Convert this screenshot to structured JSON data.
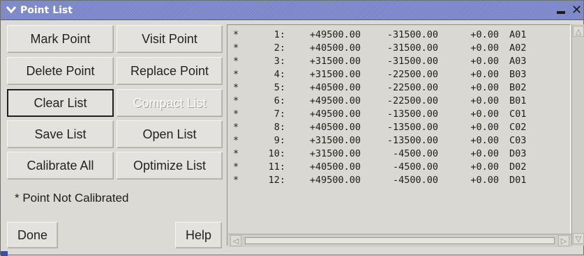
{
  "window": {
    "title": "Point List",
    "menu_icon": "chevron-down-icon",
    "minimize_glyph": "▬",
    "close_glyph": "✕",
    "title_bar_color": "#7b86c8"
  },
  "buttons": {
    "mark_point": "Mark Point",
    "visit_point": "Visit Point",
    "delete_point": "Delete Point",
    "replace_point": "Replace Point",
    "clear_list": "Clear List",
    "compact_list": "Compact List",
    "save_list": "Save List",
    "open_list": "Open List",
    "calibrate_all": "Calibrate All",
    "optimize_list": "Optimize List",
    "done": "Done",
    "help": "Help"
  },
  "legend": "* Point Not Calibrated",
  "points": [
    {
      "flag": "*",
      "index": "1:",
      "x": "+49500.00",
      "y": "-31500.00",
      "z": "+0.00",
      "label": "A01"
    },
    {
      "flag": "*",
      "index": "2:",
      "x": "+40500.00",
      "y": "-31500.00",
      "z": "+0.00",
      "label": "A02"
    },
    {
      "flag": "*",
      "index": "3:",
      "x": "+31500.00",
      "y": "-31500.00",
      "z": "+0.00",
      "label": "A03"
    },
    {
      "flag": "*",
      "index": "4:",
      "x": "+31500.00",
      "y": "-22500.00",
      "z": "+0.00",
      "label": "B03"
    },
    {
      "flag": "*",
      "index": "5:",
      "x": "+40500.00",
      "y": "-22500.00",
      "z": "+0.00",
      "label": "B02"
    },
    {
      "flag": "*",
      "index": "6:",
      "x": "+49500.00",
      "y": "-22500.00",
      "z": "+0.00",
      "label": "B01"
    },
    {
      "flag": "*",
      "index": "7:",
      "x": "+49500.00",
      "y": "-13500.00",
      "z": "+0.00",
      "label": "C01"
    },
    {
      "flag": "*",
      "index": "8:",
      "x": "+40500.00",
      "y": "-13500.00",
      "z": "+0.00",
      "label": "C02"
    },
    {
      "flag": "*",
      "index": "9:",
      "x": "+31500.00",
      "y": "-13500.00",
      "z": "+0.00",
      "label": "C03"
    },
    {
      "flag": "*",
      "index": "10:",
      "x": "+31500.00",
      "y": "-4500.00",
      "z": "+0.00",
      "label": "D03"
    },
    {
      "flag": "*",
      "index": "11:",
      "x": "+40500.00",
      "y": "-4500.00",
      "z": "+0.00",
      "label": "D02"
    },
    {
      "flag": "*",
      "index": "12:",
      "x": "+49500.00",
      "y": "-4500.00",
      "z": "+0.00",
      "label": "D01"
    }
  ],
  "scrollbars": {
    "up_arrow": "△",
    "down_arrow": "▽",
    "left_arrow": "◁",
    "right_arrow": "▷"
  }
}
